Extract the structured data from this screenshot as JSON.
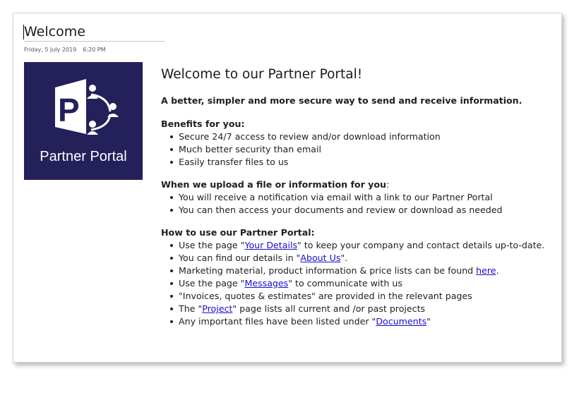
{
  "page": {
    "title": "Welcome",
    "date": "Friday, 5 July 2019",
    "time": "6:20 PM"
  },
  "logo": {
    "text": "Partner Portal",
    "bg_color": "#24205a",
    "icon": "publisher-p-share-icon"
  },
  "content": {
    "heading": "Welcome to our Partner Portal!",
    "tagline": "A better, simpler and more secure way to send and receive information.",
    "benefits": {
      "title": "Benefits for you:",
      "items": [
        "Secure 24/7 access to review and/or download information",
        "Much better security than email",
        "Easily transfer files to us"
      ]
    },
    "upload": {
      "title": "When we upload a file or information for you",
      "title_suffix": ":",
      "items": [
        "You will receive a notification via email with a link to our Partner Portal",
        "You can then access your documents and review or download as needed"
      ]
    },
    "howto": {
      "title": "How to use our Partner Portal:",
      "items": [
        {
          "pre": "Use the page \"",
          "link": "Your Details",
          "post": "\" to keep your company and contact details up-to-date."
        },
        {
          "pre": "You can find our details in \"",
          "link": "About Us",
          "post": "\"."
        },
        {
          "pre": "Marketing material, product information & price lists can be found ",
          "link": "here",
          "post": "."
        },
        {
          "pre": "Use the page \"",
          "link": "Messages",
          "post": "\" to communicate with us"
        },
        {
          "pre": "\"Invoices, quotes & estimates\" are provided in the relevant pages",
          "link": "",
          "post": ""
        },
        {
          "pre": "The \"",
          "link": "Project",
          "post": "\" page lists all current and /or past projects"
        },
        {
          "pre": "Any important files have been listed under \"",
          "link": "Documents",
          "post": "\""
        }
      ]
    }
  }
}
